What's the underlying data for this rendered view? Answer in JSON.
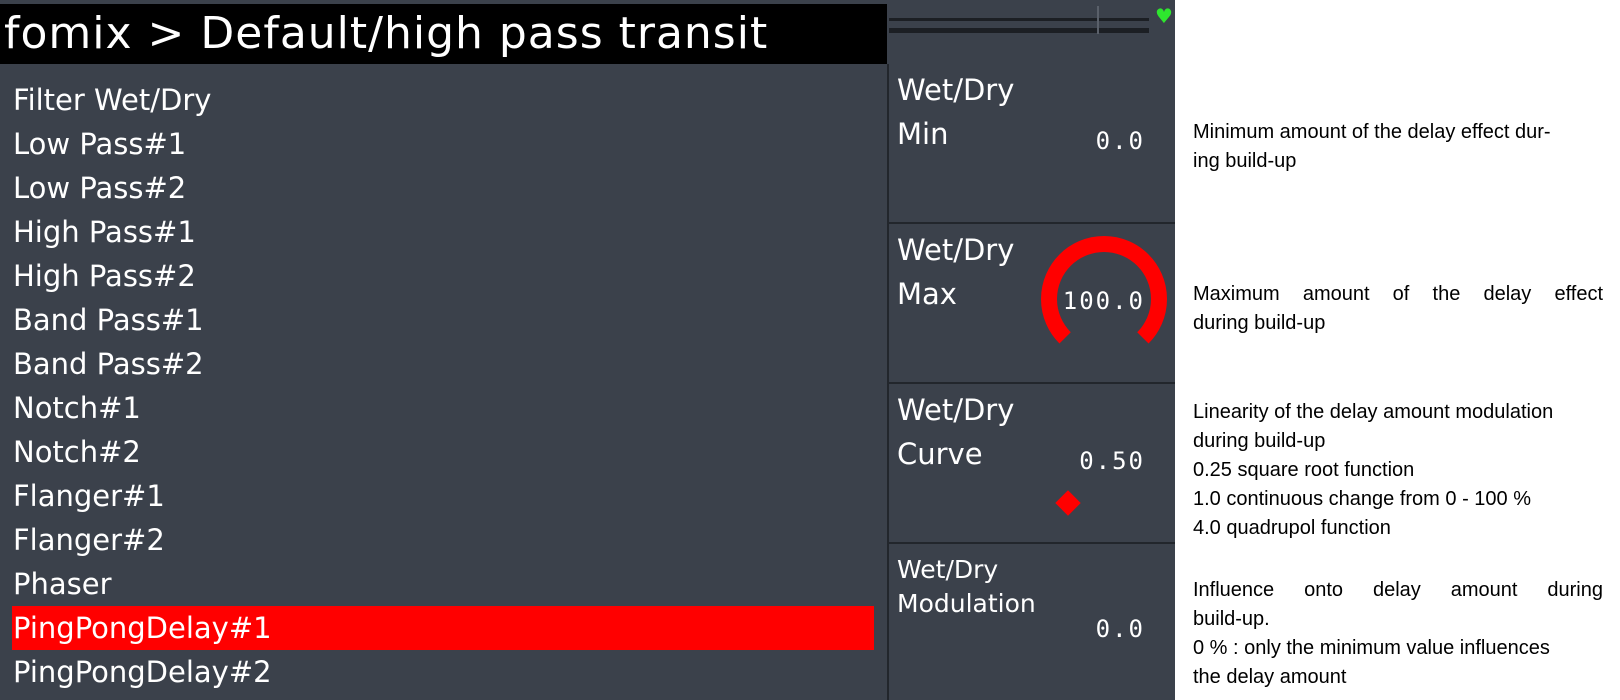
{
  "header": {
    "title": "fomix > Default/high pass transit",
    "heart_icon": "heart-icon",
    "heart_color": "#2ee62e"
  },
  "effects_list": [
    {
      "label": "Filter Wet/Dry",
      "selected": false
    },
    {
      "label": "Low Pass#1",
      "selected": false
    },
    {
      "label": "Low Pass#2",
      "selected": false
    },
    {
      "label": "High Pass#1",
      "selected": false
    },
    {
      "label": "High Pass#2",
      "selected": false
    },
    {
      "label": "Band Pass#1",
      "selected": false
    },
    {
      "label": "Band Pass#2",
      "selected": false
    },
    {
      "label": "Notch#1",
      "selected": false
    },
    {
      "label": "Notch#2",
      "selected": false
    },
    {
      "label": "Flanger#1",
      "selected": false
    },
    {
      "label": "Flanger#2",
      "selected": false
    },
    {
      "label": "Phaser",
      "selected": false
    },
    {
      "label": "PingPongDelay#1",
      "selected": true
    },
    {
      "label": "PingPongDelay#2",
      "selected": false
    }
  ],
  "params": [
    {
      "name1": "Wet/Dry",
      "name2": "Min",
      "value": "0.0"
    },
    {
      "name1": "Wet/Dry",
      "name2": "Max",
      "value": "100.0",
      "knob_fraction": 1.0
    },
    {
      "name1": "Wet/Dry",
      "name2": "Curve",
      "value": "0.50"
    },
    {
      "name1": "Wet/Dry",
      "name2": "Modulation",
      "value": "0.0"
    }
  ],
  "help": [
    {
      "lines": [
        "Minimum amount of the delay effect dur-",
        "ing build-up"
      ]
    },
    {
      "lines": [
        "Maximum amount of the delay effect",
        "during build-up"
      ]
    },
    {
      "lines": [
        "Linearity of the delay amount modulation",
        "during build-up",
        "0.25 square root function",
        "1.0 continuous change from 0 - 100 %",
        "4.0 quadrupol function"
      ]
    },
    {
      "lines": [
        "Influence onto delay amount during",
        "build-up.",
        "0 % : only the minimum value influences",
        "the delay amount"
      ]
    }
  ],
  "colors": {
    "panel": "#3b414b",
    "accent": "#ff0000",
    "title_bar": "#000000"
  }
}
